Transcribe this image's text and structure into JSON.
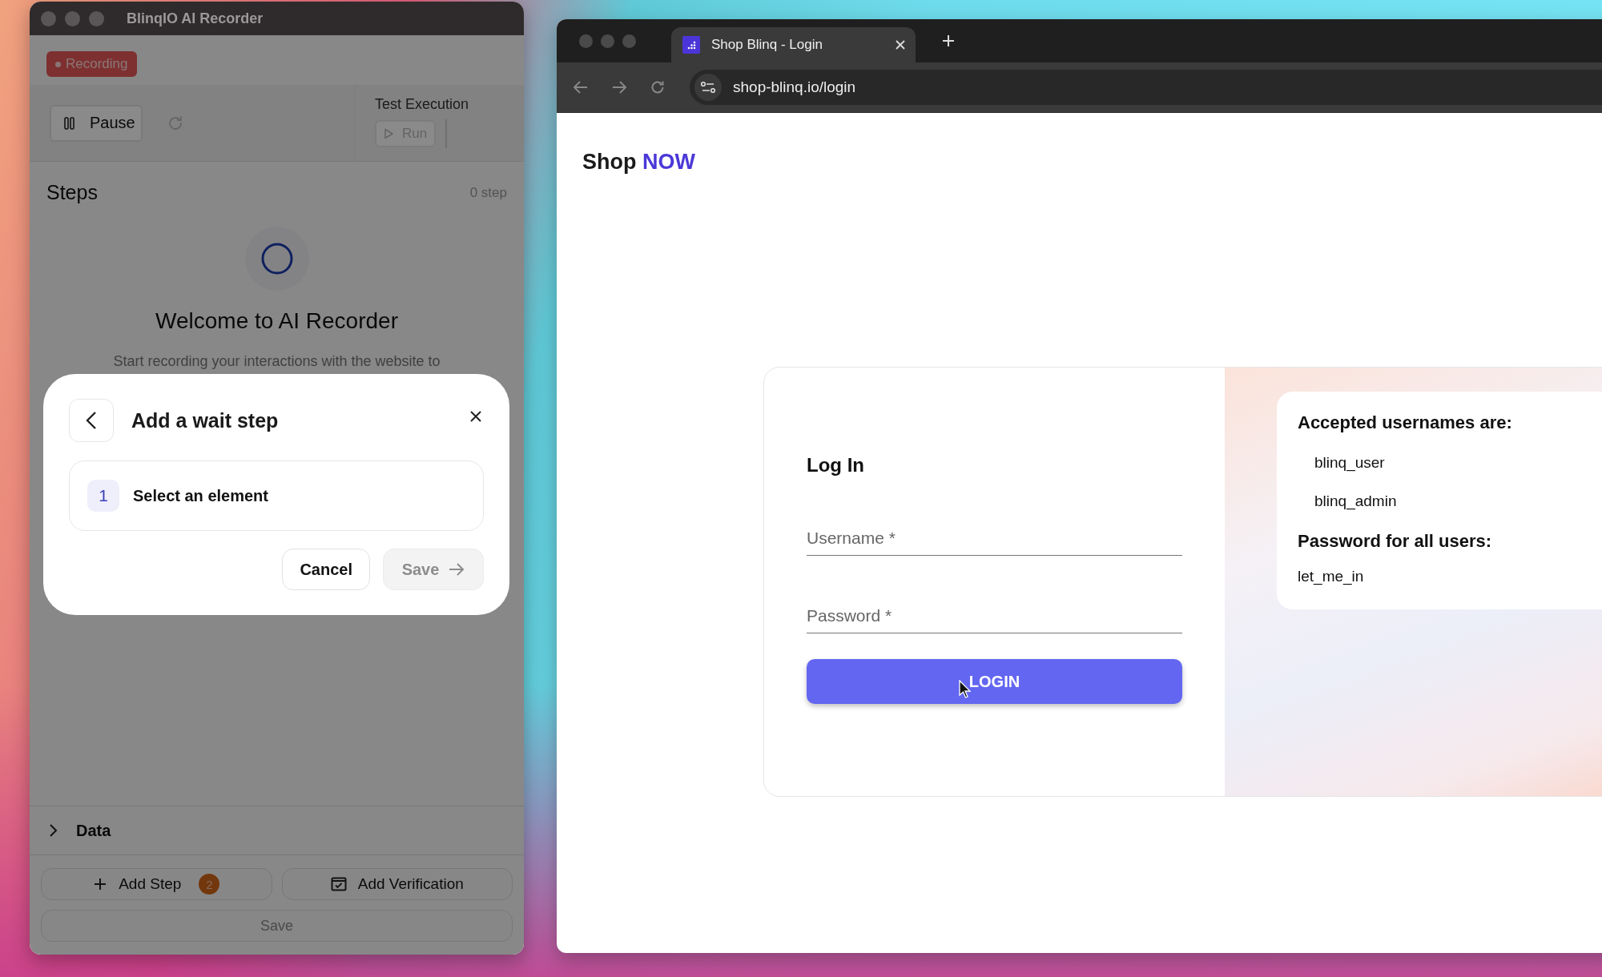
{
  "recorder": {
    "title": "BlinqIO AI Recorder",
    "status_badge": "Recording",
    "pause_button": "Pause",
    "test_execution": {
      "title": "Test Execution",
      "run_button": "Run",
      "run_disabled": true
    },
    "steps": {
      "title": "Steps",
      "count": "0 step"
    },
    "welcome": {
      "title": "Welcome to AI Recorder",
      "text": "Start recording your interactions with the website to"
    },
    "data_section": {
      "label": "Data",
      "expanded": false
    },
    "add_step_button": {
      "label": "Add Step",
      "badge": "2"
    },
    "add_verification_button": "Add Verification",
    "save_button": {
      "label": "Save",
      "disabled": true
    }
  },
  "dialog": {
    "title": "Add a wait step",
    "steps": [
      {
        "number": "1",
        "label": "Select an element"
      }
    ],
    "buttons": [
      {
        "label": "Cancel",
        "kind": "secondary",
        "disabled": false
      },
      {
        "label": "Save",
        "kind": "primary",
        "disabled": true
      }
    ]
  },
  "browser": {
    "tabs": [
      {
        "title": "Shop Blinq - Login",
        "selected": true
      }
    ],
    "url": "shop-blinq.io/login",
    "page": {
      "logo": {
        "text": "Shop",
        "accent": "NOW"
      },
      "login": {
        "title": "Log In",
        "fields": [
          {
            "placeholder": "Username *"
          },
          {
            "placeholder": "Password *"
          }
        ],
        "button": "LOGIN"
      },
      "info": {
        "usernames_title": "Accepted usernames are:",
        "usernames": [
          "blinq_user",
          "blinq_admin"
        ],
        "password_title": "Password for all users:",
        "password": "let_me_in"
      }
    }
  }
}
